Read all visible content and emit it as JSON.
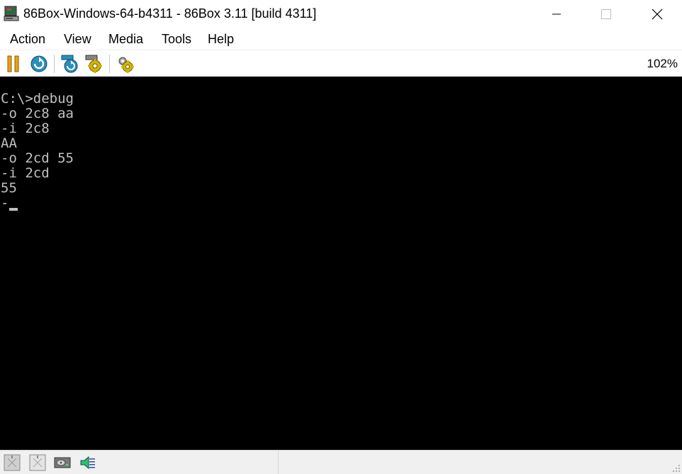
{
  "window": {
    "title": "86Box-Windows-64-b4311 - 86Box 3.11 [build 4311]",
    "app_icon": "computer-icon"
  },
  "menu": {
    "items": [
      "Action",
      "View",
      "Media",
      "Tools",
      "Help"
    ]
  },
  "toolbar": {
    "buttons": [
      "pause-icon",
      "reset-icon",
      "ctrl-alt-del-icon",
      "ctrl-alt-esc-icon",
      "settings-icon"
    ],
    "zoom": "102%"
  },
  "terminal": {
    "lines": [
      "C:\\>debug",
      "-o 2c8 aa",
      "-i 2c8",
      "AA",
      "-o 2cd 55",
      "-i 2cd",
      "55",
      "-"
    ],
    "text_color": "#c0c0c0",
    "background": "#000000"
  },
  "statusbar": {
    "icons": [
      "floppy-drive-a-icon",
      "floppy-drive-b-icon",
      "hard-disk-icon",
      "sound-icon"
    ]
  },
  "colors": {
    "pause": "#e8a317",
    "reset": "#2a8fbd",
    "gear": "#d4b400"
  }
}
